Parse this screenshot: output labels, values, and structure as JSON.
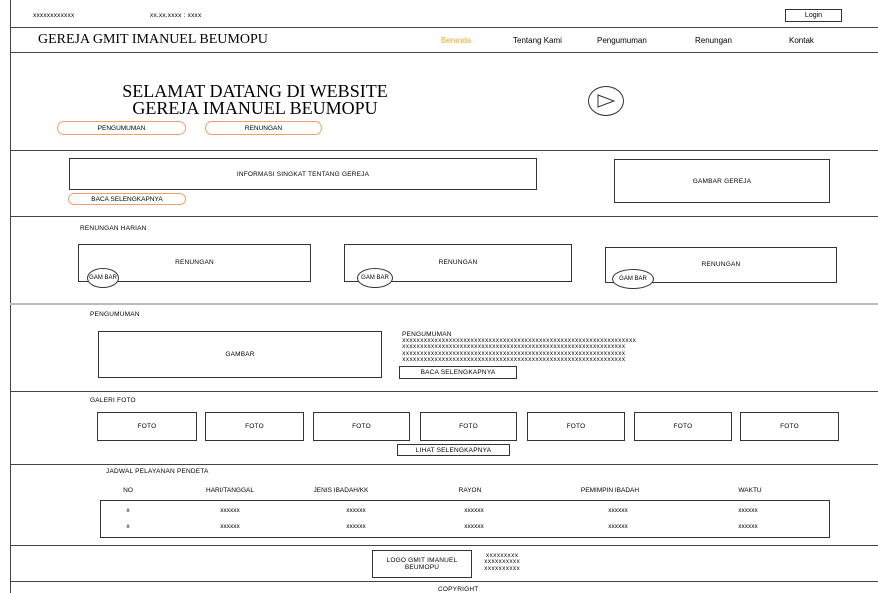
{
  "topbar": {
    "contact": "xxxxxxxxxxxx",
    "datetime": "xx,xx,xxxx : xxxx",
    "login_label": "Login"
  },
  "brand": {
    "name": "GEREJA GMIT IMANUEL BEUMOPU"
  },
  "nav": {
    "items": [
      "Beranda",
      "Tentang Kami",
      "Pengumuman",
      "Renungan",
      "Kontak"
    ],
    "active_color": "#f5a623"
  },
  "hero": {
    "title_line1": "SELAMAT DATANG DI WEBSITE",
    "title_line2": "GEREJA IMANUEL BEUMOPU",
    "btn_pengumuman": "PENGUMUMAN",
    "btn_renungan": "RENUNGAN"
  },
  "about": {
    "info": "INFORMASI SINGKAT TENTANG GEREJA",
    "read_more": "BACA SELENGKAPNYA",
    "image": "GAMBAR GEREJA"
  },
  "devotional": {
    "heading": "RENUNGAN HARIAN",
    "cards": [
      {
        "title": "RENUNGAN",
        "img": "GAM BAR"
      },
      {
        "title": "RENUNGAN",
        "img": "GAM BAR"
      },
      {
        "title": "RENUNGAN",
        "img": "GAM BAR"
      }
    ]
  },
  "announcement": {
    "heading": "PENGUMUMAN",
    "image": "GAMBAR",
    "title": "PENGUMUMAN",
    "lines": [
      "xxxxxxxxxxxxxxxxxxxxxxxxxxxxxxxxxxxxxxxxxxxxxxxxxxxxxxxxxxxxxxxxx",
      "xxxxxxxxxxxxxxxxxxxxxxxxxxxxxxxxxxxxxxxxxxxxxxxxxxxxxxxxxxxxxx",
      "xxxxxxxxxxxxxxxxxxxxxxxxxxxxxxxxxxxxxxxxxxxxxxxxxxxxxxxxxxxxxx",
      "xxxxxxxxxxxxxxxxxxxxxxxxxxxxxxxxxxxxxxxxxxxxxxxxxxxxxxxxxxxxxx"
    ],
    "read_more": "BACA SELENGKAPNYA"
  },
  "gallery": {
    "heading": "GALERI FOTO",
    "photos": [
      "FOTO",
      "FOTO",
      "FOTO",
      "FOTO",
      "FOTO",
      "FOTO",
      "FOTO"
    ],
    "see_more": "LIHAT SELENGKAPNYA"
  },
  "schedule": {
    "heading": "JADWAL PELAYANAN PENDETA",
    "columns": [
      "NO",
      "HARI/TANGGAL",
      "JENIS IBADAH/KK",
      "RAYON",
      "PEMIMPIN IBADAH",
      "WAKTU"
    ],
    "rows": [
      [
        "x",
        "xxxxxx",
        "xxxxxx",
        "xxxxxx",
        "xxxxxx",
        "xxxxxx"
      ],
      [
        "x",
        "xxxxxx",
        "xxxxxx",
        "xxxxxx",
        "xxxxxx",
        "xxxxxx"
      ]
    ]
  },
  "footer": {
    "logo": "LOGO GMIT IMANUEL BEUMOPU",
    "info_lines": [
      "xxxxxxxxx",
      "xxxxxxxxxx",
      "xxxxxxxxxx"
    ],
    "copyright": "COPYRIGHT"
  }
}
